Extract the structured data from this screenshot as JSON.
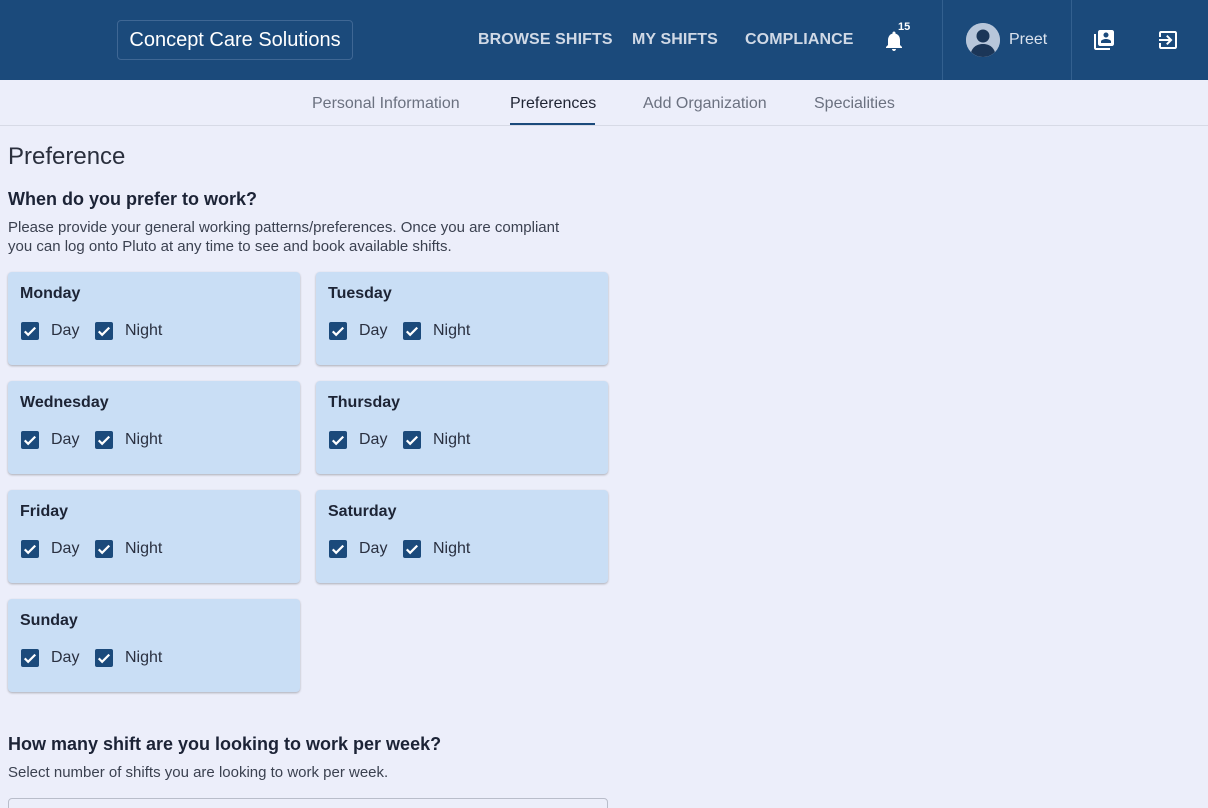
{
  "header": {
    "brand": "Concept Care Solutions",
    "nav": [
      "BROWSE SHIFTS",
      "MY SHIFTS",
      "COMPLIANCE"
    ],
    "notification_count": "15",
    "user_name": "Preet"
  },
  "tabs": [
    "Personal Information",
    "Preferences",
    "Add Organization",
    "Specialities"
  ],
  "active_tab": "Preferences",
  "page": {
    "title": "Preference",
    "work_heading": "When do you prefer to work?",
    "work_desc_1": "Please provide your general working patterns/preferences. Once you are compliant",
    "work_desc_2": "you can log onto Pluto at any time to see and book available shifts.",
    "shifts_heading": "How many shift are you looking to work per week?",
    "shifts_desc": "Select number of shifts you are looking to work per week."
  },
  "days": [
    {
      "name": "Monday",
      "day_label": "Day",
      "night_label": "Night",
      "day": true,
      "night": true
    },
    {
      "name": "Tuesday",
      "day_label": "Day",
      "night_label": "Night",
      "day": true,
      "night": true
    },
    {
      "name": "Wednesday",
      "day_label": "Day",
      "night_label": "Night",
      "day": true,
      "night": true
    },
    {
      "name": "Thursday",
      "day_label": "Day",
      "night_label": "Night",
      "day": true,
      "night": true
    },
    {
      "name": "Friday",
      "day_label": "Day",
      "night_label": "Night",
      "day": true,
      "night": true
    },
    {
      "name": "Saturday",
      "day_label": "Day",
      "night_label": "Night",
      "day": true,
      "night": true
    },
    {
      "name": "Sunday",
      "day_label": "Day",
      "night_label": "Night",
      "day": true,
      "night": true
    }
  ],
  "colors": {
    "header_bg": "#1b4a7b",
    "page_bg": "#eceefa",
    "card_bg": "#c9def5",
    "checkbox": "#1b4a7b"
  },
  "icons": [
    "notification-bell-icon",
    "user-avatar-icon",
    "contacts-book-icon",
    "logout-icon",
    "checkbox-check-icon"
  ]
}
